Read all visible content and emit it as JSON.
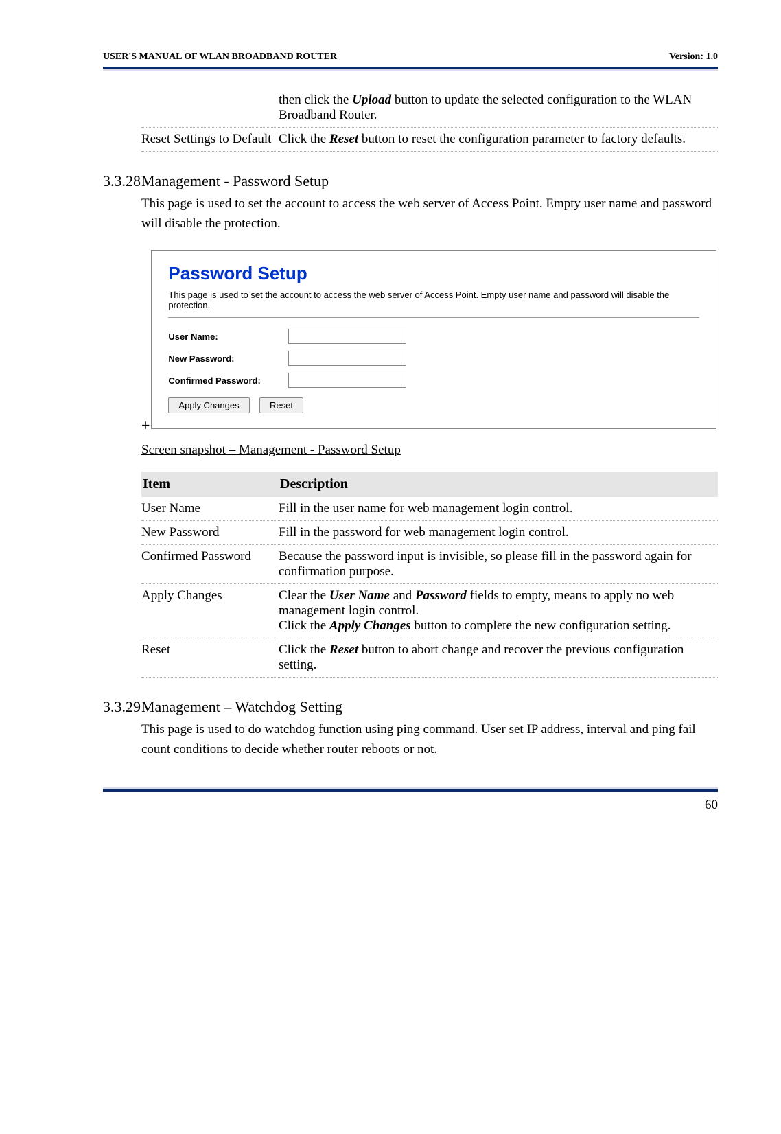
{
  "header": {
    "left": "USER'S MANUAL OF WLAN BROADBAND ROUTER",
    "right": "Version: 1.0"
  },
  "table1": {
    "rows": [
      {
        "item": "",
        "desc_parts": [
          "then click the ",
          "Upload",
          " button to update the selected configuration to the WLAN Broadband Router."
        ]
      },
      {
        "item": "Reset Settings to Default",
        "desc_parts": [
          "Click the ",
          "Reset",
          " button to reset the configuration parameter to factory defaults."
        ]
      }
    ]
  },
  "section28": {
    "number": "3.3.28",
    "title": "Management - Password Setup",
    "intro": "This page is used to set the account to access the web server of Access Point. Empty user name and password will disable the protection."
  },
  "screenshot": {
    "title": "Password Setup",
    "desc": "This page is used to set the account to access the web server of Access Point. Empty user name and password will disable the protection.",
    "labels": {
      "user_name": "User Name:",
      "new_password": "New Password:",
      "confirmed_password": "Confirmed Password:"
    },
    "buttons": {
      "apply": "Apply Changes",
      "reset": "Reset"
    }
  },
  "caption": "Screen snapshot – Management - Password Setup",
  "table2": {
    "head": {
      "item": "Item",
      "desc": "Description"
    },
    "rows": {
      "user_name": {
        "item": "User Name",
        "desc_plain": "Fill in the user name for web management login control."
      },
      "new_password": {
        "item": "New Password",
        "desc_plain": "Fill in the password for web management login control."
      },
      "confirmed_password": {
        "item": "Confirmed Password",
        "desc_plain": "Because the password input is invisible, so please fill in the password again for confirmation purpose."
      },
      "apply_changes": {
        "item": "Apply Changes",
        "p1_a": "Clear the ",
        "p1_b": "User Name",
        "p1_c": " and ",
        "p1_d": "Password",
        "p1_e": " fields to empty, means to apply no web management login control.",
        "p2_a": "Click the ",
        "p2_b": "Apply Changes",
        "p2_c": " button to complete the new configuration setting."
      },
      "reset": {
        "item": "Reset",
        "p_a": "Click the ",
        "p_b": "Reset",
        "p_c": " button to abort change and recover the previous configuration setting."
      }
    }
  },
  "section29": {
    "number": "3.3.29",
    "title": "Management – Watchdog Setting",
    "intro": "This page is used to do watchdog function using ping command. User set IP address, interval and ping fail count conditions to decide whether router reboots or not."
  },
  "page_number": "60",
  "plus": "+"
}
